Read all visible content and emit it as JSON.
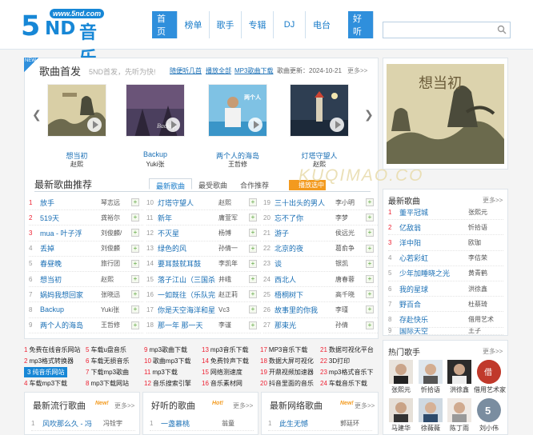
{
  "site": {
    "logo_url": "www.5nd.com",
    "logo_five": "5",
    "logo_nd": "ND",
    "logo_text": "音乐"
  },
  "nav": [
    "首页",
    "榜单",
    "歌手",
    "专辑",
    "DJ",
    "电台",
    "好听"
  ],
  "search": {
    "placeholder": ""
  },
  "first_release": {
    "badge": "NEW",
    "title": "歌曲首发",
    "subtitle": "5ND首发，先听为快!",
    "links": [
      "随便听几首",
      "播放全部",
      "MP3歌曲下载"
    ],
    "update": "歌曲更新：2024-10-21",
    "more": "更多>>",
    "cards": [
      {
        "title": "想当初",
        "artist": "赵熙"
      },
      {
        "title": "Backup",
        "artist": "Yuki张"
      },
      {
        "title": "两个人的海岛",
        "artist": "王哲修"
      },
      {
        "title": "灯塔守望人",
        "artist": "赵熙"
      }
    ]
  },
  "recommend": {
    "title": "最新歌曲推荐",
    "tabs": [
      "最新歌曲",
      "最受歌曲",
      "合作推荐"
    ],
    "play_btn": "播放选中",
    "col1": [
      {
        "n": "1",
        "t": "放手",
        "a": "琴志远"
      },
      {
        "n": "2",
        "t": "519天",
        "a": "龚裕尔"
      },
      {
        "n": "3",
        "t": "mua - 叶子浮",
        "a": "刘俊麟/"
      },
      {
        "n": "4",
        "t": "丢掉",
        "a": "刘俊麟"
      },
      {
        "n": "5",
        "t": "春昼晚",
        "a": "旅行团"
      },
      {
        "n": "6",
        "t": "想当初",
        "a": "赵熙"
      },
      {
        "n": "7",
        "t": "娲妈我想回家",
        "a": "张晓迅"
      },
      {
        "n": "8",
        "t": "Backup",
        "a": "Yuki张"
      },
      {
        "n": "9",
        "t": "两个人的海岛",
        "a": "王哲修"
      }
    ],
    "col2": [
      {
        "n": "10",
        "t": "灯塔守望人",
        "a": "赵熙"
      },
      {
        "n": "11",
        "t": "新年",
        "a": "庸萱军"
      },
      {
        "n": "12",
        "t": "不灭星",
        "a": "杨博"
      },
      {
        "n": "13",
        "t": "绿色的风",
        "a": "孙倩一"
      },
      {
        "n": "14",
        "t": "要耳鼓就耳鼓",
        "a": "李凯年"
      },
      {
        "n": "15",
        "t": "落子江山（三国杀",
        "a": "井峨"
      },
      {
        "n": "16",
        "t": "一如既往（乐队完",
        "a": "赵正莉"
      },
      {
        "n": "17",
        "t": "你是天空海洋和星",
        "a": "Vc3"
      },
      {
        "n": "18",
        "t": "那一年 那一天",
        "a": "李谨"
      }
    ],
    "col3": [
      {
        "n": "19",
        "t": "三十出头的男人",
        "a": "李小明"
      },
      {
        "n": "20",
        "t": "忘不了你",
        "a": "李梦"
      },
      {
        "n": "21",
        "t": "游子",
        "a": "侯远光"
      },
      {
        "n": "22",
        "t": "北京的夜",
        "a": "葛俞争"
      },
      {
        "n": "23",
        "t": "谈",
        "a": "银凯"
      },
      {
        "n": "24",
        "t": "西北人",
        "a": "唐春蓉"
      },
      {
        "n": "25",
        "t": "梧桐树下",
        "a": "高千晓"
      },
      {
        "n": "26",
        "t": "故事里的你我",
        "a": "李瑾"
      },
      {
        "n": "27",
        "t": "那束光",
        "a": "孙倩"
      }
    ]
  },
  "links": [
    [
      "1",
      "免费在线音乐网站"
    ],
    [
      "2",
      "mp3格式转换器"
    ],
    [
      "3",
      "纯音乐网站"
    ],
    [
      "4",
      "车载mp3下载"
    ],
    [
      "5",
      "车载u盘音乐"
    ],
    [
      "6",
      "车载无损音乐"
    ],
    [
      "7",
      "下载mp3歌曲"
    ],
    [
      "8",
      "mp3下载网站"
    ],
    [
      "9",
      "mp3歌曲下载"
    ],
    [
      "10",
      "歌曲mp3下载"
    ],
    [
      "11",
      "mp3下载"
    ],
    [
      "12",
      "音乐搜索引擎"
    ],
    [
      "13",
      "mp3音乐下载"
    ],
    [
      "14",
      "免费铃声下载"
    ],
    [
      "15",
      "网络测速度"
    ],
    [
      "16",
      "音乐素材网"
    ],
    [
      "17",
      "MP3音乐下载"
    ],
    [
      "18",
      "数据大屏可视化"
    ],
    [
      "19",
      "开鼎视频加速器"
    ],
    [
      "20",
      "抖音里面的音乐"
    ],
    [
      "21",
      "数据可视化平台"
    ],
    [
      "22",
      "3D打印"
    ],
    [
      "23",
      "mp3格式音乐下"
    ],
    [
      "24",
      "车载音乐下载"
    ]
  ],
  "bottom": {
    "latest_popular": {
      "title": "最新流行歌曲",
      "tag": "New!",
      "more": "更多>>",
      "first": {
        "n": "1",
        "t": "风吹那么久 - 冯",
        "a": "冯铨宇"
      }
    },
    "good": {
      "title": "好听的歌曲",
      "tag": "Hot!",
      "more": "更多>>",
      "first": {
        "n": "1",
        "t": "一盏慕桃",
        "a": "翁童"
      }
    },
    "network": {
      "title": "最新网络歌曲",
      "tag": "New!",
      "more": "更多>>",
      "first": {
        "n": "1",
        "t": "此生无憾",
        "a": "郭廷环"
      }
    }
  },
  "side": {
    "latest": {
      "title": "最新歌曲",
      "more": "更多>>",
      "items": [
        {
          "t": "董平冠城",
          "a": "张熙元"
        },
        {
          "t": "亿敌翁",
          "a": "忻拾语"
        },
        {
          "t": "洋中阳",
          "a": "欧珈"
        },
        {
          "t": "心若彩虹",
          "a": "李佶荣"
        },
        {
          "t": "少年加睡晓之光",
          "a": "黄青鹤"
        },
        {
          "t": "我的星球",
          "a": "洪徐鑫"
        },
        {
          "t": "野百合",
          "a": "杜蔡琦"
        },
        {
          "t": "存赴快乐",
          "a": "借用艺术"
        },
        {
          "t": "国际天空",
          "a": "王子"
        }
      ]
    },
    "hot_singers": {
      "title": "热门歌手",
      "more": "更多>>",
      "singers": [
        "张熙元",
        "忻拾语",
        "洪徐鑫",
        "借用艺术家",
        "马建华",
        "徐薇薇",
        "陈丁雨",
        "刘小伟"
      ]
    }
  },
  "watermark": "KUQIMAO.CO"
}
